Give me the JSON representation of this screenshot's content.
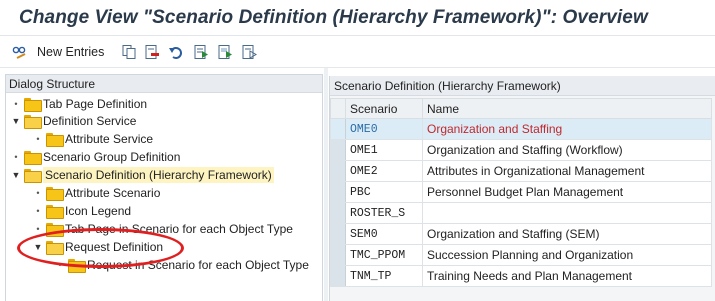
{
  "title": "Change View \"Scenario Definition (Hierarchy Framework)\": Overview",
  "toolbar": {
    "new_entries_label": "New Entries",
    "icons": [
      "glasses-pencil-icon",
      "copy-icon",
      "delete-icon",
      "undo-icon",
      "select-all-icon",
      "select-block-icon",
      "deselect-all-icon"
    ]
  },
  "dialog_structure": {
    "header": "Dialog Structure",
    "items": [
      {
        "label": "Tab Page Definition",
        "level": 1,
        "expander": "bullet"
      },
      {
        "label": "Definition Service",
        "level": 1,
        "expander": "expanded"
      },
      {
        "label": "Attribute Service",
        "level": 2,
        "expander": "bullet"
      },
      {
        "label": "Scenario Group Definition",
        "level": 1,
        "expander": "bullet"
      },
      {
        "label": "Scenario Definition (Hierarchy Framework)",
        "level": 1,
        "expander": "expanded",
        "selected": true
      },
      {
        "label": "Attribute Scenario",
        "level": 2,
        "expander": "bullet"
      },
      {
        "label": "Icon Legend",
        "level": 2,
        "expander": "bullet"
      },
      {
        "label": "Tab Page in Scenario for each Object Type",
        "level": 2,
        "expander": "bullet"
      },
      {
        "label": "Request Definition",
        "level": 2,
        "expander": "expanded"
      },
      {
        "label": "Request in Scenario for each Object Type",
        "level": 3,
        "expander": "bullet"
      }
    ]
  },
  "table": {
    "title": "Scenario Definition (Hierarchy Framework)",
    "columns": [
      "Scenario",
      "Name"
    ],
    "rows": [
      {
        "scenario": "OME0",
        "name": "Organization and Staffing",
        "highlight": true
      },
      {
        "scenario": "OME1",
        "name": "Organization and Staffing (Workflow)"
      },
      {
        "scenario": "OME2",
        "name": "Attributes in Organizational Management"
      },
      {
        "scenario": "PBC",
        "name": "Personnel Budget Plan Management"
      },
      {
        "scenario": "ROSTER_S",
        "name": ""
      },
      {
        "scenario": "SEM0",
        "name": "Organization and Staffing (SEM)"
      },
      {
        "scenario": "TMC_PPOM",
        "name": "Succession Planning and Organization"
      },
      {
        "scenario": "TNM_TP",
        "name": "Training Needs and Plan Management"
      }
    ]
  },
  "colors": {
    "highlight_name": "#c0282d",
    "highlight_code": "#2a6ca8",
    "selected_tree_bg": "#fdf4c2",
    "annotation_ellipse": "#e02020"
  }
}
